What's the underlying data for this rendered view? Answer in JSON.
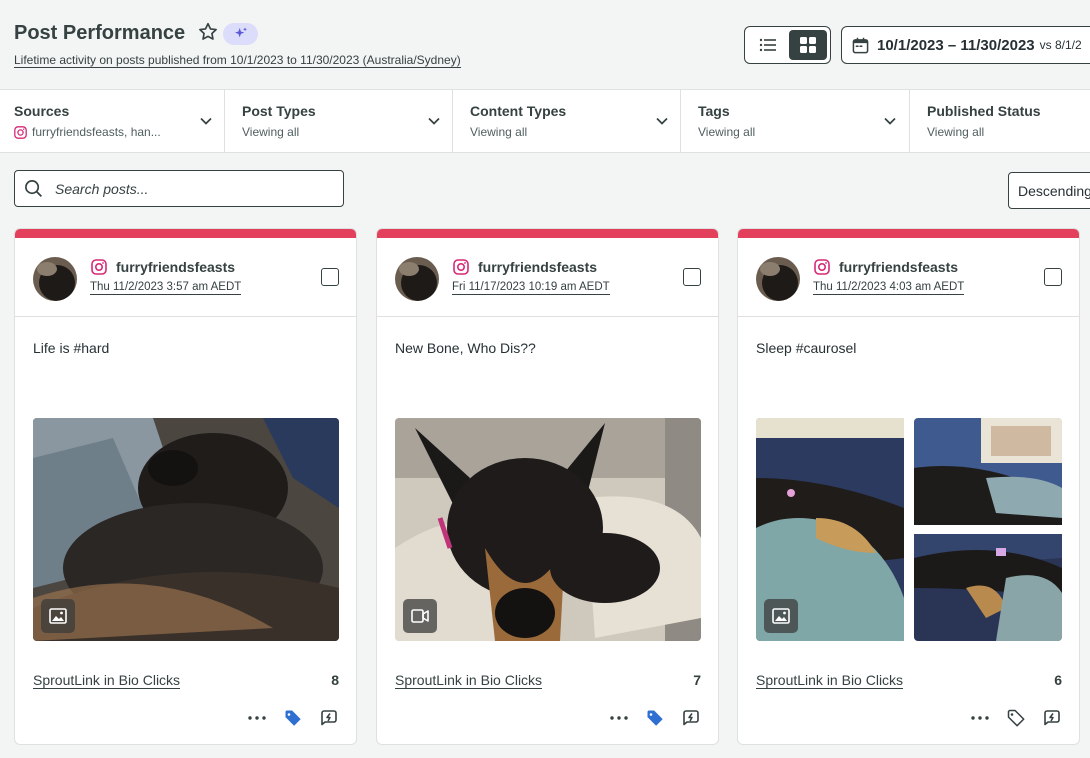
{
  "header": {
    "title": "Post Performance",
    "subtitle": "Lifetime activity on posts published from 10/1/2023 to 11/30/2023 (Australia/Sydney)"
  },
  "date_picker": {
    "range": "10/1/2023 – 11/30/2023",
    "compare": "vs 8/1/2"
  },
  "filters": [
    {
      "label": "Sources",
      "value": "furryfriendsfeasts, han..."
    },
    {
      "label": "Post Types",
      "value": "Viewing all"
    },
    {
      "label": "Content Types",
      "value": "Viewing all"
    },
    {
      "label": "Tags",
      "value": "Viewing all"
    },
    {
      "label": "Published Status",
      "value": "Viewing all"
    }
  ],
  "search": {
    "placeholder": "Search posts..."
  },
  "sort": {
    "label": "Descending"
  },
  "colors": {
    "accent_bar": "#e3415b",
    "instagram": "#d62976",
    "tag_active": "#2f6fd1"
  },
  "posts": [
    {
      "handle": "furryfriendsfeasts",
      "date": "Thu 11/2/2023 3:57 am AEDT",
      "caption": "Life is #hard",
      "media_type": "image-icon",
      "metric_label": "SproutLink in Bio Clicks",
      "metric_value": "8",
      "tagged": true
    },
    {
      "handle": "furryfriendsfeasts",
      "date": "Fri 11/17/2023 10:19 am AEDT",
      "caption": "New Bone, Who Dis??",
      "media_type": "video-icon",
      "metric_label": "SproutLink in Bio Clicks",
      "metric_value": "7",
      "tagged": true
    },
    {
      "handle": "furryfriendsfeasts",
      "date": "Thu 11/2/2023 4:03 am AEDT",
      "caption": "Sleep #caurosel",
      "media_type": "image-icon",
      "metric_label": "SproutLink in Bio Clicks",
      "metric_value": "6",
      "tagged": false
    }
  ]
}
